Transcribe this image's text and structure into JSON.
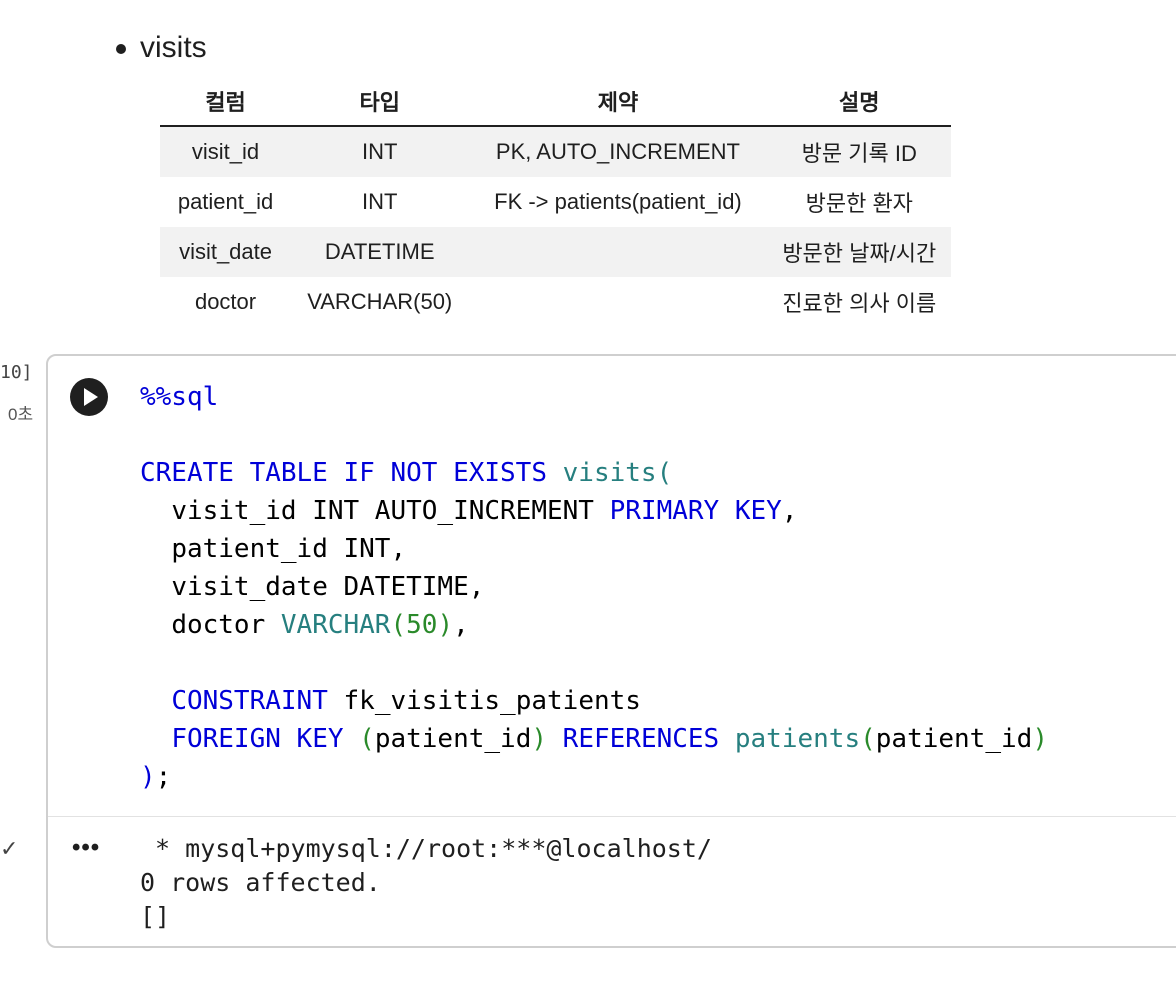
{
  "markdown": {
    "list_item": "visits",
    "table": {
      "headers": [
        "컬럼",
        "타입",
        "제약",
        "설명"
      ],
      "rows": [
        [
          "visit_id",
          "INT",
          "PK, AUTO_INCREMENT",
          "방문 기록 ID"
        ],
        [
          "patient_id",
          "INT",
          "FK -> patients(patient_id)",
          "방문한 환자"
        ],
        [
          "visit_date",
          "DATETIME",
          "",
          "방문한 날짜/시간"
        ],
        [
          "doctor",
          "VARCHAR(50)",
          "",
          "진료한 의사 이름"
        ]
      ]
    }
  },
  "cell": {
    "execution_count": "10]",
    "execution_time": "0초",
    "status_icon": "check-icon",
    "run_icon": "play-icon",
    "code_lines": {
      "magic": "%%sql",
      "create_kw": "CREATE TABLE IF NOT EXISTS",
      "table_name": "visits",
      "col1_name": "visit_id INT AUTO_INCREMENT",
      "col1_kw": "PRIMARY KEY",
      "col2": "patient_id INT,",
      "col3": "visit_date DATETIME,",
      "col4_name": "doctor",
      "col4_type": "VARCHAR",
      "col4_len": "50",
      "constraint_kw": "CONSTRAINT",
      "constraint_name": "fk_visitis_patients",
      "fk_kw": "FOREIGN KEY",
      "fk_col": "patient_id",
      "ref_kw": "REFERENCES",
      "ref_table": "patients",
      "ref_col": "patient_id"
    },
    "output_menu_icon": "more-horiz-icon",
    "output_lines": [
      " * mysql+pymysql://root:***@localhost/",
      "0 rows affected.",
      "[]"
    ]
  }
}
